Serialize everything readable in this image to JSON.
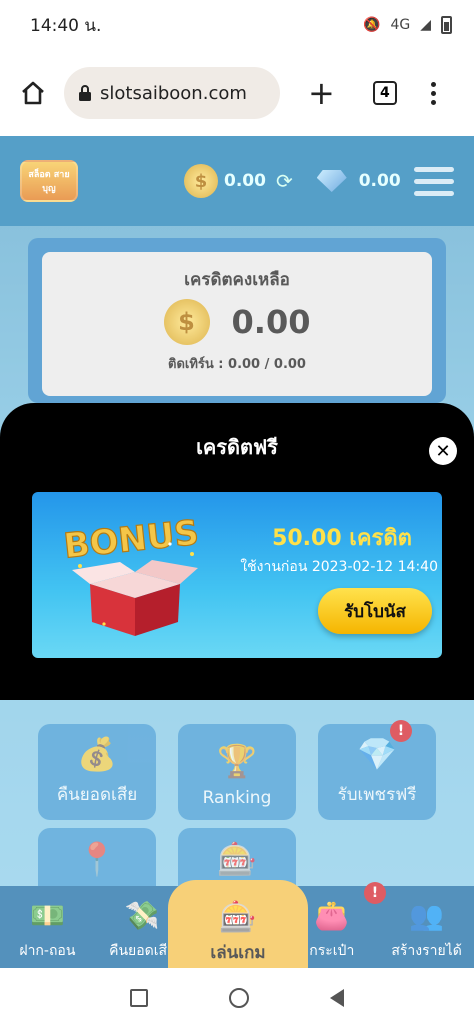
{
  "status_bar": {
    "time": "14:40 น.",
    "network": "4G"
  },
  "browser": {
    "url": "slotsaiboon.com",
    "tab_count": "4"
  },
  "header": {
    "logo_text": "สล็อต สายบุญ",
    "coin_balance": "0.00",
    "gem_balance": "0.00"
  },
  "credit": {
    "title": "เครดิตคงเหลือ",
    "amount": "0.00",
    "turnover": "ติดเทิร์น : 0.00 / 0.00"
  },
  "tiles": [
    {
      "label": "คืนยอดเสีย"
    },
    {
      "label": "Ranking"
    },
    {
      "label": "รับเพชรฟรี",
      "badge": "!"
    }
  ],
  "bottom_nav": {
    "deposit": "ฝาก-ถอน",
    "cashback": "คืนยอดเสีย",
    "play": "เล่นเกม",
    "wallet": "กระเป๋า",
    "wallet_badge": "!",
    "affiliate": "สร้างรายได้"
  },
  "modal": {
    "title": "เครดิตฟรี",
    "bonus_art_text": "BONUS",
    "bonus_amount": "50.00 เครดิต",
    "expire": "ใช้งานก่อน 2023-02-12 14:40",
    "claim_label": "รับโบนัส"
  }
}
